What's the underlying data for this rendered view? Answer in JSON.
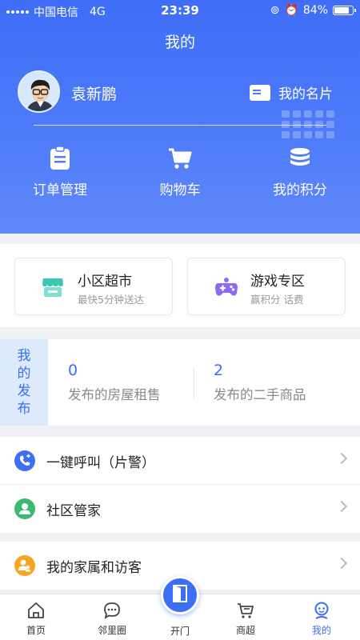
{
  "status_bar": {
    "carrier": "中国电信",
    "network": "4G",
    "time": "23:39",
    "battery": "84%",
    "battery_level": 0.84
  },
  "header": {
    "title": "我的"
  },
  "profile": {
    "name": "袁新鹏",
    "namecard_label": "我的名片"
  },
  "quick_actions": [
    {
      "label": "订单管理",
      "icon": "order-list-icon"
    },
    {
      "label": "购物车",
      "icon": "cart-icon"
    },
    {
      "label": "我的积分",
      "icon": "points-stack-icon"
    }
  ],
  "services": [
    {
      "title": "小区超市",
      "subtitle": "最快5分钟送达",
      "icon": "store-icon",
      "color": "#3cc6b4"
    },
    {
      "title": "游戏专区",
      "subtitle": "赢积分 话费",
      "icon": "gamepad-icon",
      "color": "#8b6cf0"
    }
  ],
  "my_posts": {
    "tag": [
      "我",
      "的",
      "发",
      "布"
    ],
    "stats": [
      {
        "count": "0",
        "label": "发布的房屋租售"
      },
      {
        "count": "2",
        "label": "发布的二手商品"
      }
    ]
  },
  "menu": [
    {
      "label": "一键呼叫（片警）",
      "icon": "phone-icon",
      "color": "#3d6ef5"
    },
    {
      "label": "社区管家",
      "icon": "person-icon",
      "color": "#3cba72"
    },
    {
      "label": "我的家属和访客",
      "icon": "family-icon",
      "color": "#f5a623"
    }
  ],
  "tabbar": {
    "items": [
      {
        "label": "首页",
        "icon": "home-icon"
      },
      {
        "label": "邻里圈",
        "icon": "chat-icon"
      },
      {
        "label": "开门",
        "icon": "door-icon"
      },
      {
        "label": "商超",
        "icon": "cart-icon"
      },
      {
        "label": "我的",
        "icon": "profile-icon"
      }
    ],
    "active": "我的",
    "accent": "#3d6ef5"
  }
}
